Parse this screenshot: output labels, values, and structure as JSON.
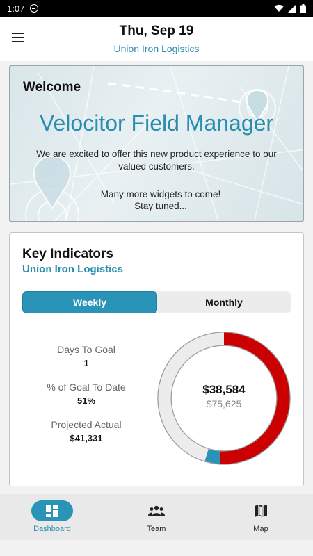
{
  "status_bar": {
    "time": "1:07"
  },
  "header": {
    "date": "Thu, Sep 19",
    "company": "Union Iron Logistics"
  },
  "welcome": {
    "title": "Welcome",
    "heading": "Velocitor Field Manager",
    "text": "We are excited to offer this new product experience to our valued customers.",
    "text2_line1": "Many more widgets to come!",
    "text2_line2": "Stay tuned..."
  },
  "kpi": {
    "title": "Key Indicators",
    "company": "Union Iron Logistics",
    "tabs": {
      "weekly": "Weekly",
      "monthly": "Monthly"
    },
    "stats": [
      {
        "label": "Days To Goal",
        "value": "1"
      },
      {
        "label": "% of Goal To Date",
        "value": "51%"
      },
      {
        "label": "Projected Actual",
        "value": "$41,331"
      }
    ],
    "donut": {
      "value": "$38,584",
      "goal": "$75,625",
      "actual_fraction": 0.51,
      "projected_fraction": 0.547,
      "colors": {
        "actual": "#cc0000",
        "projected": "#2a93b8",
        "remaining": "#ececec"
      }
    }
  },
  "bottom_nav": {
    "items": [
      {
        "label": "Dashboard",
        "icon": "dashboard-icon",
        "active": true
      },
      {
        "label": "Team",
        "icon": "team-icon",
        "active": false
      },
      {
        "label": "Map",
        "icon": "map-icon",
        "active": false
      }
    ]
  }
}
